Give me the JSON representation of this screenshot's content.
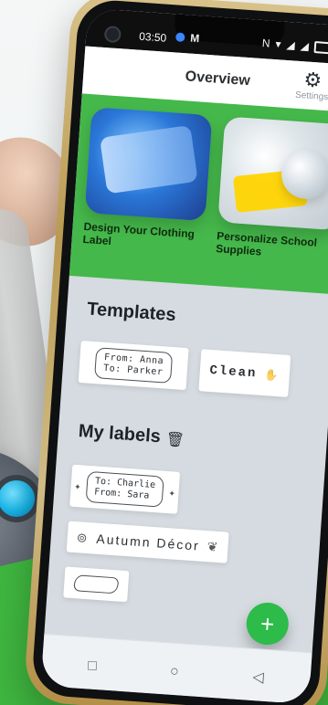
{
  "statusbar": {
    "time": "03:50",
    "gmail": "M"
  },
  "header": {
    "title": "Overview",
    "settings_label": "Settings"
  },
  "promos": [
    {
      "label": "Design Your Clothing Label"
    },
    {
      "label": "Personalize School Supplies"
    }
  ],
  "templates": {
    "title": "Templates",
    "items": [
      {
        "line1": "From: Anna",
        "line2": "To: Parker"
      },
      {
        "text": "Clean"
      }
    ]
  },
  "my_labels": {
    "title": "My labels",
    "items": [
      {
        "line1": "To: Charlie",
        "line2": "From: Sara"
      },
      {
        "text": "Autumn Décor"
      },
      {
        "text": ""
      }
    ]
  },
  "colors": {
    "brand_green": "#45b84b",
    "fab_green": "#2dbb4a"
  }
}
